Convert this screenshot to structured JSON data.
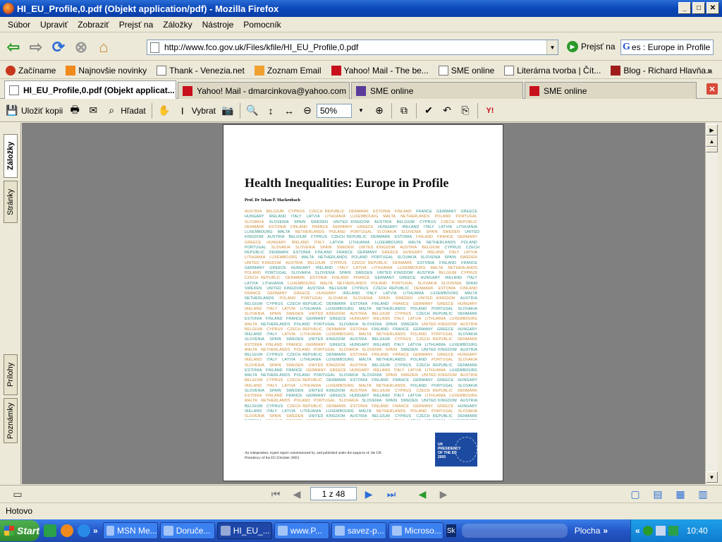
{
  "window": {
    "title": "HI_EU_Profile,0.pdf (Objekt application/pdf) - Mozilla Firefox"
  },
  "menu": [
    "Súbor",
    "Upraviť",
    "Zobraziť",
    "Prejsť na",
    "Záložky",
    "Nástroje",
    "Pomocník"
  ],
  "nav": {
    "url": "http://www.fco.gov.uk/Files/kfile/HI_EU_Profile,0.pdf",
    "go_label": "Prejsť na",
    "search_value": "es : Europe in Profile"
  },
  "bookmarks": [
    "Začíname",
    "Najnovšie novinky",
    "Thank - Venezia.net",
    "Zoznam Email",
    "Yahoo! Mail - The be...",
    "SME online",
    "Literárna tvorba | Čít...",
    "Blog - Richard Hlavňa..."
  ],
  "tabs": [
    "HI_EU_Profile,0.pdf (Objekt applicat...",
    "Yahoo! Mail - dmarcinkova@yahoo.com",
    "SME online",
    "SME online"
  ],
  "pdf_toolbar": {
    "save_copy": "Uložiť kopii",
    "find": "Hľadat",
    "select": "Vybrat",
    "zoom": "50%"
  },
  "side_tabs": [
    "Záložky",
    "Stránky",
    "Prílohy",
    "Poznámky"
  ],
  "document": {
    "title": "Health Inequalities: Europe in Profile",
    "author": "Prof. Dr Johan P. Mackenbach",
    "countries": [
      "AUSTRIA",
      "BELGIUM",
      "CYPRUS",
      "CZECH REPUBLIC",
      "DENMARK",
      "ESTONIA",
      "FINLAND",
      "FRANCE",
      "GERMANY",
      "GREECE",
      "HUNGARY",
      "IRELAND",
      "ITALY",
      "LATVIA",
      "LITHUANIA",
      "LUXEMBOURG",
      "MALTA",
      "NETHERLANDS",
      "POLAND",
      "PORTUGAL",
      "SLOVAKIA",
      "SLOVENIA",
      "SPAIN",
      "SWEDEN",
      "UNITED KINGDOM"
    ],
    "footer": "An independent, expert report commissioned by, and published under the auspices of, the UK Presidency of the EU (October 2005)",
    "logo_text": [
      "UK",
      "PRESIDENCY",
      "OF THE EU",
      "2005"
    ]
  },
  "pager": {
    "page": "1 z 48"
  },
  "status": "Hotovo",
  "taskbar": {
    "start": "Start",
    "tasks": [
      "MSN Me...",
      "Doruče...",
      "HI_EU_...",
      "www.P...",
      "savez-p...",
      "Microso..."
    ],
    "plocha": "Plocha",
    "clock": "10:40"
  },
  "colors": {
    "title_bar": "#0a47b8",
    "taskbar": "#2457c8",
    "country_orange": "#c8872c",
    "country_teal": "#2f8f86"
  }
}
